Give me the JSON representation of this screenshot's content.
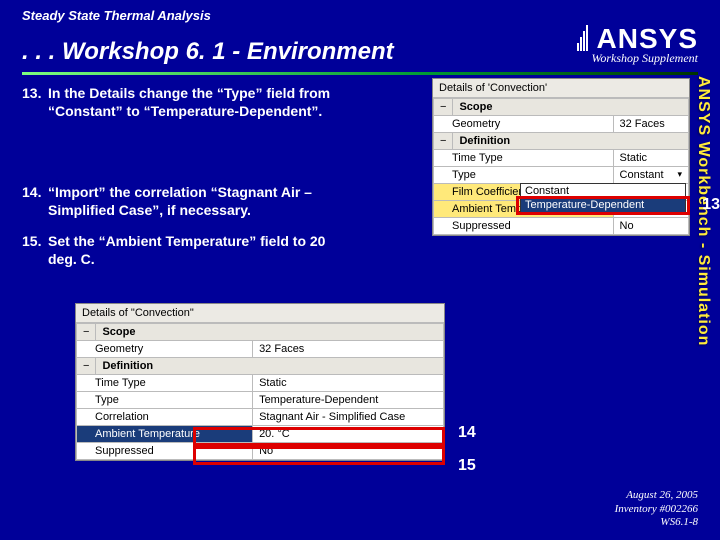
{
  "header": {
    "pretitle": "Steady State Thermal Analysis",
    "title": ". . . Workshop 6. 1 - Environment",
    "brand": "ANSYS",
    "supplement": "Workshop Supplement"
  },
  "sidebar_text": "ANSYS Workbench - Simulation",
  "steps": {
    "s13": {
      "num": "13.",
      "body": "In the Details change the “Type” field from “Constant” to “Temperature-Dependent”."
    },
    "s14": {
      "num": "14.",
      "body": "“Import” the correlation “Stagnant Air – Simplified Case”, if necessary."
    },
    "s15": {
      "num": "15.",
      "body": "Set the “Ambient Temperature” field to 20 deg. C."
    }
  },
  "panelA": {
    "title": "Details of 'Convection'",
    "scope_hdr": "Scope",
    "geometry_lab": "Geometry",
    "geometry_val": "32 Faces",
    "def_hdr": "Definition",
    "timetype_lab": "Time Type",
    "timetype_val": "Static",
    "type_lab": "Type",
    "type_val": "Constant",
    "film_lab": "Film Coefficient",
    "film_val": "Constant",
    "amb_lab": "Ambient Temperature",
    "amb_val": "",
    "supp_lab": "Suppressed",
    "supp_val": "No"
  },
  "dropdown": {
    "opt1": "Constant",
    "opt2": "Temperature-Dependent"
  },
  "panelB": {
    "title": "Details of \"Convection\"",
    "scope_hdr": "Scope",
    "geometry_lab": "Geometry",
    "geometry_val": "32 Faces",
    "def_hdr": "Definition",
    "timetype_lab": "Time Type",
    "timetype_val": "Static",
    "type_lab": "Type",
    "type_val": "Temperature-Dependent",
    "corr_lab": "Correlation",
    "corr_val": "Stagnant Air - Simplified Case",
    "amb_lab": "Ambient Temperature",
    "amb_val": "20. °C",
    "supp_lab": "Suppressed",
    "supp_val": "No"
  },
  "callouts": {
    "c13": "13",
    "c14": "14",
    "c15": "15"
  },
  "footer": {
    "date": "August 26, 2005",
    "inv": "Inventory #002266",
    "pg": "WS6.1-8"
  },
  "glyph": {
    "minus": "−",
    "dd": "▾"
  }
}
